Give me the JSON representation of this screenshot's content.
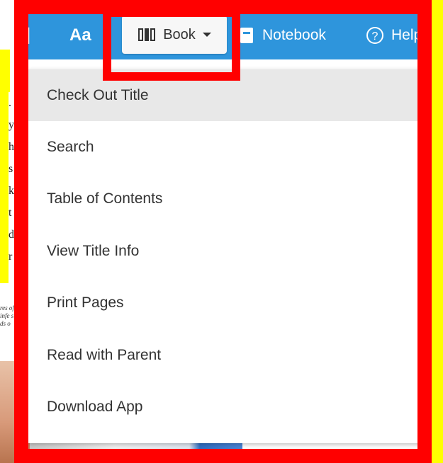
{
  "toolbar": {
    "aa_label": "Aa",
    "book_label": "Book",
    "notebook_label": "Notebook",
    "help_label": "Help"
  },
  "menu": {
    "items": [
      {
        "label": "Check Out Title",
        "active": true
      },
      {
        "label": "Search"
      },
      {
        "label": "Table of Contents"
      },
      {
        "label": "View Title Info"
      },
      {
        "label": "Print Pages"
      },
      {
        "label": "Read with Parent"
      },
      {
        "label": "Download App"
      }
    ]
  },
  "colors": {
    "toolbar_bg": "#2e95dc",
    "highlight_red": "#ff0000",
    "highlight_yellow": "#ffff00",
    "menu_active_bg": "#e8e8e8"
  },
  "icons": {
    "bookmark": "bookmark-icon",
    "book": "book-icon",
    "notebook": "notebook-icon",
    "help": "help-circle-icon",
    "caret": "chevron-down-icon"
  },
  "background": {
    "text_fragments": [
      ".",
      "y a",
      "h o",
      "s s",
      "k",
      "t",
      "d",
      "r a"
    ],
    "italic_fragments": [
      "res of",
      "infe s",
      "ds o"
    ]
  }
}
